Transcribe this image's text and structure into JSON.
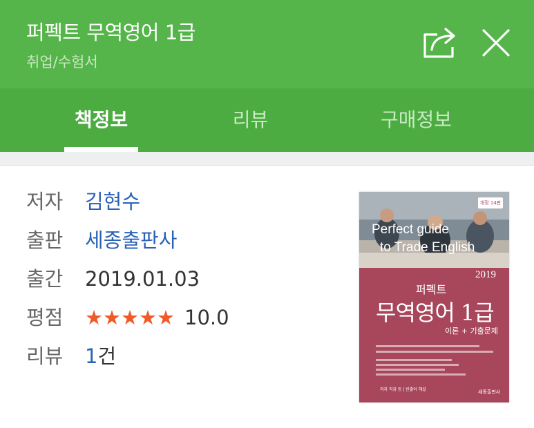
{
  "header": {
    "title": "퍼펙트 무역영어 1급",
    "category": "취업/수험서",
    "share_icon": "share-icon",
    "close_icon": "close-icon",
    "background": "#55b54a"
  },
  "tabs": [
    {
      "label": "책정보",
      "active": true
    },
    {
      "label": "리뷰",
      "active": false
    },
    {
      "label": "구매정보",
      "active": false
    }
  ],
  "info": {
    "author_label": "저자",
    "author": "김현수",
    "publisher_label": "출판",
    "publisher": "세종출판사",
    "date_label": "출간",
    "date": "2019.01.03",
    "rating_label": "평점",
    "stars": "★★★★★",
    "stars_value": 5,
    "rating": "10.0",
    "review_label": "리뷰",
    "review_count": "1",
    "review_suffix": "건",
    "link_color": "#2a62b8",
    "star_color": "#f05a28"
  },
  "cover": {
    "badge": "개정 14판",
    "english_line1": "Perfect guide",
    "english_line2": "to Trade English",
    "year": "2019",
    "small_title": "퍼펙트",
    "main_title": "무역영어 1급",
    "subtitle": "이론 + 기출문제",
    "bottom_text": "저자 직강 등 | 빈출어 해설",
    "publisher": "세종출판사",
    "background": "#a8475c"
  }
}
